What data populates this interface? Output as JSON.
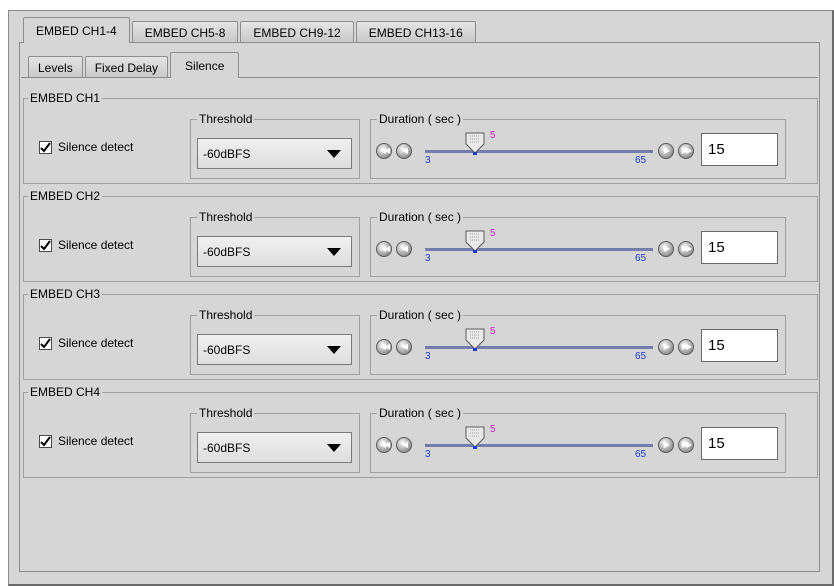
{
  "outer_tabs": [
    "EMBED CH1-4",
    "EMBED CH5-8",
    "EMBED CH9-12",
    "EMBED CH13-16"
  ],
  "inner_tabs": [
    "Levels",
    "Fixed Delay",
    "Silence"
  ],
  "channels": [
    {
      "title": "EMBED CH1",
      "checkbox_label": "Silence detect",
      "checked": true,
      "threshold_label": "Threshold",
      "threshold_value": "-60dBFS",
      "duration_label": "Duration ( sec )",
      "slider_min": "3",
      "slider_max": "65",
      "slider_current": "5",
      "field_value": "15"
    },
    {
      "title": "EMBED CH2",
      "checkbox_label": "Silence detect",
      "checked": true,
      "threshold_label": "Threshold",
      "threshold_value": "-60dBFS",
      "duration_label": "Duration ( sec )",
      "slider_min": "3",
      "slider_max": "65",
      "slider_current": "5",
      "field_value": "15"
    },
    {
      "title": "EMBED CH3",
      "checkbox_label": "Silence detect",
      "checked": true,
      "threshold_label": "Threshold",
      "threshold_value": "-60dBFS",
      "duration_label": "Duration ( sec )",
      "slider_min": "3",
      "slider_max": "65",
      "slider_current": "5",
      "field_value": "15"
    },
    {
      "title": "EMBED CH4",
      "checkbox_label": "Silence detect",
      "checked": true,
      "threshold_label": "Threshold",
      "threshold_value": "-60dBFS",
      "duration_label": "Duration ( sec )",
      "slider_min": "3",
      "slider_max": "65",
      "slider_current": "5",
      "field_value": "15"
    }
  ],
  "icons": {
    "checkbox": "check-mark-icon",
    "dropdown": "chevron-down-icon",
    "step_left_fast": "double-left-icon",
    "step_left": "left-icon",
    "step_right": "right-icon",
    "step_right_fast": "double-right-icon",
    "slider_thumb": "slider-thumb-icon"
  },
  "colors": {
    "slider_track": "#757caa",
    "tick_label": "#1a3adb",
    "current_value": "#d01fd0"
  }
}
